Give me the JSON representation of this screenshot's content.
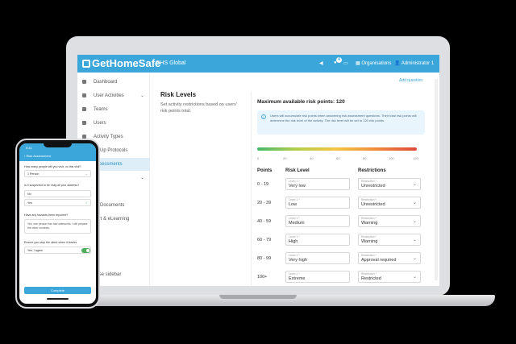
{
  "topbar": {
    "brand": "GetHomeSafe",
    "org": "GHS Global",
    "notification_count": "4",
    "organisations": "Organisations",
    "user": "Administrator 1"
  },
  "sidebar": {
    "items": [
      {
        "label": "Dashboard"
      },
      {
        "label": "User Activities",
        "chevron": "⌄"
      },
      {
        "label": "Teams"
      },
      {
        "label": "Users"
      },
      {
        "label": "Activity Types"
      },
      {
        "label": "ns Up Protocols"
      },
      {
        "label": "Assessments"
      },
      {
        "label": "s",
        "chevron": "⌄"
      },
      {
        "label": "rts"
      },
      {
        "label": "ey Documents"
      },
      {
        "label": "port & eLearning"
      },
      {
        "label": "apse sidebar"
      }
    ]
  },
  "add_link": "Add question",
  "section": {
    "title": "Risk Levels",
    "description": "Set activity restrictions based on users' risk points total."
  },
  "card": {
    "max_points": "Maximum available risk points: 120",
    "info": "Users will accumulate risk points when answering risk assessment questions. Their total risk points will determine the risk level of the activity. The risk level will be set to 120 risk points.",
    "scale": [
      "0",
      "20",
      "40",
      "60",
      "80",
      "100",
      "120"
    ],
    "headers": {
      "points": "Points",
      "risk": "Risk Level",
      "restrictions": "Restrictions"
    },
    "level_label": "Level 1 *",
    "restriction_label": "Restriction *",
    "rows": [
      {
        "points": "0 - 19",
        "level": "Very low",
        "restriction": "Unrestricted"
      },
      {
        "points": "20 - 39",
        "level": "Low",
        "restriction": "Unrestricted"
      },
      {
        "points": "40 - 59",
        "level": "Medium",
        "restriction": "Warning"
      },
      {
        "points": "60 - 79",
        "level": "High",
        "restriction": "Warning"
      },
      {
        "points": "80 - 99",
        "level": "Very high",
        "restriction": "Approval required"
      },
      {
        "points": "100+",
        "level": "Extreme",
        "restriction": "Restricted"
      }
    ]
  },
  "phone": {
    "time": "9:41",
    "nav_back": "‹ Risk Assessment",
    "title": "Risk Assessment",
    "q1": "How many people will you visit, on this visit?",
    "a1": "1 Person",
    "q2": "Is it suspected to be risky at your address?",
    "a2": "No",
    "a3": "Yes",
    "q3": "Have any hazards been reported?",
    "a4": "Yes, one person has had sideworks. I will prepare the other contexts.",
    "q4": "Ensure you stop the client when it leaves",
    "a5": "Yes, I agree",
    "button": "Complete"
  }
}
